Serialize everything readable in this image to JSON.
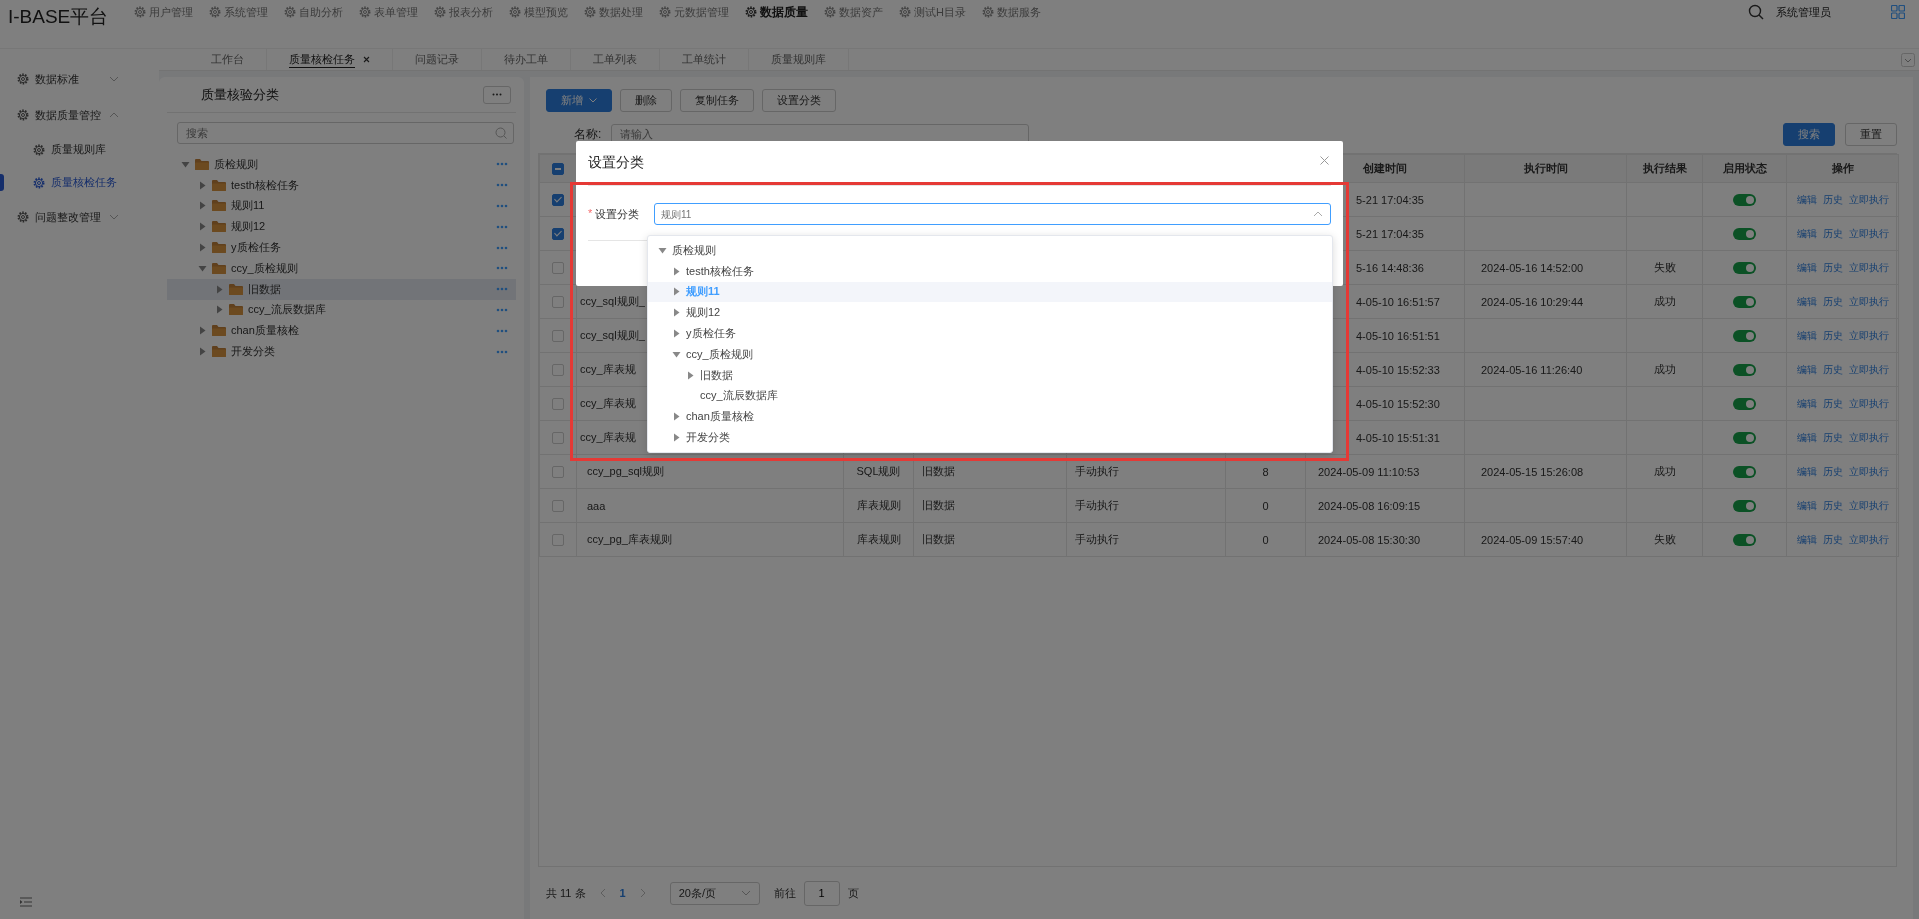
{
  "header": {
    "logo": "I-BASE平台",
    "menu": [
      {
        "label": "用户管理",
        "selected": false
      },
      {
        "label": "系统管理",
        "selected": false
      },
      {
        "label": "自助分析",
        "selected": false
      },
      {
        "label": "表单管理",
        "selected": false
      },
      {
        "label": "报表分析",
        "selected": false
      },
      {
        "label": "模型预览",
        "selected": false
      },
      {
        "label": "数据处理",
        "selected": false
      },
      {
        "label": "元数据管理",
        "selected": false
      },
      {
        "label": "数据质量",
        "selected": true
      },
      {
        "label": "数据资产",
        "selected": false
      },
      {
        "label": "测试H目录",
        "selected": false
      },
      {
        "label": "数据服务",
        "selected": false
      }
    ],
    "user": "系统管理员"
  },
  "tabs": [
    {
      "label": "工作台",
      "selected": false,
      "closable": false
    },
    {
      "label": "质量核检任务",
      "selected": true,
      "closable": true
    },
    {
      "label": "问题记录",
      "selected": false,
      "closable": false
    },
    {
      "label": "待办工单",
      "selected": false,
      "closable": false
    },
    {
      "label": "工单列表",
      "selected": false,
      "closable": false
    },
    {
      "label": "工单统计",
      "selected": false,
      "closable": false
    },
    {
      "label": "质量规则库",
      "selected": false,
      "closable": false
    }
  ],
  "sidebar": {
    "items": [
      {
        "label": "数据标准",
        "expanded": false
      },
      {
        "label": "数据质量管控",
        "expanded": true,
        "children": [
          {
            "label": "质量规则库",
            "selected": false
          },
          {
            "label": "质量核检任务",
            "selected": true
          }
        ]
      },
      {
        "label": "问题整改管理",
        "expanded": false
      }
    ]
  },
  "category_panel": {
    "title": "质量核验分类",
    "search": {
      "placeholder": "搜索"
    },
    "tree": [
      {
        "label": "质检规则",
        "expanded": true,
        "selected": false,
        "children": [
          {
            "label": "testh核检任务",
            "expanded": false,
            "selected": false
          },
          {
            "label": "规则11",
            "expanded": false,
            "selected": false
          },
          {
            "label": "规则12",
            "expanded": false,
            "selected": false
          },
          {
            "label": "y质检任务",
            "expanded": false,
            "selected": false
          },
          {
            "label": "ccy_质检规则",
            "expanded": true,
            "selected": false,
            "children": [
              {
                "label": "旧数据",
                "expanded": false,
                "selected": true
              },
              {
                "label": "ccy_流辰数据库",
                "expanded": false,
                "selected": false
              }
            ]
          },
          {
            "label": "chan质量核检",
            "expanded": false,
            "selected": false
          },
          {
            "label": "开发分类",
            "expanded": false,
            "selected": false
          }
        ]
      }
    ]
  },
  "toolbar": {
    "buttons": [
      {
        "label": "新增",
        "kind": "primary"
      },
      {
        "label": "删除",
        "kind": "default"
      },
      {
        "label": "复制任务",
        "kind": "default"
      },
      {
        "label": "设置分类",
        "kind": "default"
      }
    ]
  },
  "filters": {
    "label": "名称:",
    "placeholder": "请输入",
    "search_button": "搜索",
    "reset_button": "重置"
  },
  "table": {
    "header_checkbox": {
      "indeterminate": true
    },
    "columns": [
      "创建时间",
      "执行时间",
      "执行结果",
      "启用状态",
      "操作"
    ],
    "rows": [
      {
        "checked": true,
        "covered": true,
        "created": "5-21 17:04:35",
        "enabled": true,
        "actions": [
          "编辑",
          "历史",
          "立即执行"
        ]
      },
      {
        "checked": true,
        "covered": true,
        "created": "5-21 17:04:35",
        "enabled": true,
        "actions": [
          "编辑",
          "历史",
          "立即执行"
        ]
      },
      {
        "checked": false,
        "covered": true,
        "created": "5-16 14:48:36",
        "executed": "2024-05-16 14:52:00",
        "result": "失败",
        "enabled": true,
        "actions": [
          "编辑",
          "历史",
          "立即执行"
        ]
      },
      {
        "checked": false,
        "covered": true,
        "name": "ccy_sql规则_",
        "created": "4-05-10 16:51:57",
        "executed": "2024-05-16 10:29:44",
        "result": "成功",
        "enabled": true,
        "actions": [
          "编辑",
          "历史",
          "立即执行"
        ]
      },
      {
        "checked": false,
        "covered": true,
        "name": "ccy_sql规则_",
        "created": "4-05-10 16:51:51",
        "enabled": true,
        "actions": [
          "编辑",
          "历史",
          "立即执行"
        ]
      },
      {
        "checked": false,
        "covered": true,
        "name": "ccy_库表规",
        "created": "4-05-10 15:52:33",
        "executed": "2024-05-16 11:26:40",
        "result": "成功",
        "enabled": true,
        "actions": [
          "编辑",
          "历史",
          "立即执行"
        ]
      },
      {
        "checked": false,
        "covered": true,
        "name": "ccy_库表规",
        "created": "4-05-10 15:52:30",
        "enabled": true,
        "actions": [
          "编辑",
          "历史",
          "立即执行"
        ]
      },
      {
        "checked": false,
        "covered": true,
        "name": "ccy_库表规",
        "created": "4-05-10 15:51:31",
        "enabled": true,
        "actions": [
          "编辑",
          "历史",
          "立即执行"
        ]
      },
      {
        "checked": false,
        "covered": false,
        "name": "ccy_pg_sql规则",
        "type": "SQL规则",
        "category": "旧数据",
        "mode": "手动执行",
        "count": "8",
        "created": "2024-05-09 11:10:53",
        "executed": "2024-05-15 15:26:08",
        "result": "成功",
        "enabled": true,
        "actions": [
          "编辑",
          "历史",
          "立即执行"
        ]
      },
      {
        "checked": false,
        "covered": false,
        "name": "aaa",
        "type": "库表规则",
        "category": "旧数据",
        "mode": "手动执行",
        "count": "0",
        "created": "2024-05-08 16:09:15",
        "enabled": true,
        "actions": [
          "编辑",
          "历史",
          "立即执行"
        ]
      },
      {
        "checked": false,
        "covered": false,
        "name": "ccy_pg_库表规则",
        "type": "库表规则",
        "category": "旧数据",
        "mode": "手动执行",
        "count": "0",
        "created": "2024-05-08 15:30:30",
        "executed": "2024-05-09 15:57:40",
        "result": "失败",
        "enabled": true,
        "actions": [
          "编辑",
          "历史",
          "立即执行"
        ]
      }
    ]
  },
  "pagination": {
    "total": "共 11 条",
    "page": "1",
    "page_size": "20条/页",
    "goto_label": "前往",
    "goto_value": "1",
    "page_suffix": "页"
  },
  "dialog": {
    "title": "设置分类",
    "field": {
      "label": "设置分类",
      "required_mark": "*",
      "placeholder": "规则11"
    },
    "options": [
      {
        "label": "质检规则",
        "expanded": true,
        "selected": false,
        "children": [
          {
            "label": "testh核检任务",
            "expanded": false,
            "selected": false
          },
          {
            "label": "规则11",
            "expanded": false,
            "selected": true
          },
          {
            "label": "规则12",
            "expanded": false,
            "selected": false
          },
          {
            "label": "y质检任务",
            "expanded": false,
            "selected": false
          },
          {
            "label": "ccy_质检规则",
            "expanded": true,
            "selected": false,
            "children": [
              {
                "label": "旧数据",
                "expanded": false,
                "selected": false
              },
              {
                "label": "ccy_流辰数据库",
                "selected": false
              }
            ]
          },
          {
            "label": "chan质量核检",
            "expanded": false,
            "selected": false
          },
          {
            "label": "开发分类",
            "expanded": false,
            "selected": false
          }
        ]
      }
    ]
  }
}
